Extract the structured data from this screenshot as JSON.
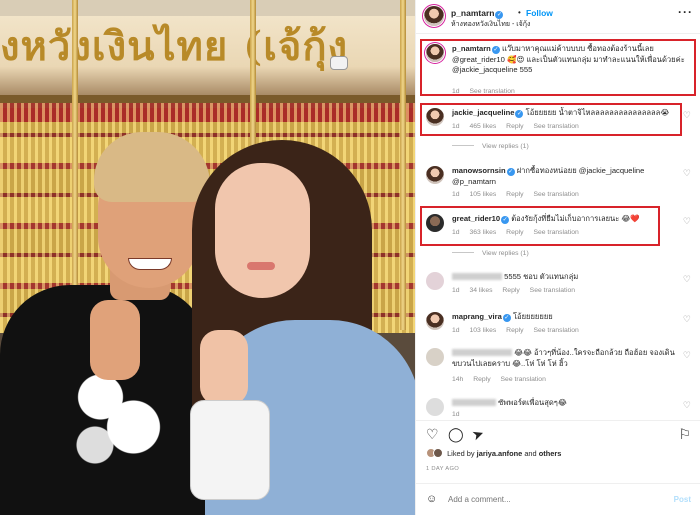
{
  "header": {
    "username": "p_namtarn",
    "follow_label": "Follow",
    "location": "ห้างทองหวังเงินไทย - เจ้กุ้ง",
    "more_icon": "more-horizontal-icon"
  },
  "photo": {
    "sign_text": "งหวังเงินไทย (เจ้กุ้ง"
  },
  "comments": [
    {
      "username": "p_namtarn",
      "verified": true,
      "text": "แว๊บมาหาคุณแม่ค้าบบบบ ซื้อทองต้องร้านนี้เลย @great_rider10 🥰😍 และเป็นตัวแทนกลุ่ม มาทำละแนนให้เพื่อนด้วยค่ะ @jackie_jacqueline 555",
      "time": "1d",
      "translate": "See translation"
    },
    {
      "username": "jackie_jacqueline",
      "verified": true,
      "text": "โอ้ยยยยย น้ำตาจิไหลลลลลลลลลลลลลลล😭",
      "time": "1d",
      "likes": "465 likes",
      "reply": "Reply",
      "translate": "See translation",
      "view_replies": "View replies (1)"
    },
    {
      "username": "manowsornsin",
      "verified": true,
      "text": "ฝากซื้อทองหน่อยย @jackie_jacqueline @p_namtarn",
      "time": "1d",
      "likes": "105 likes",
      "reply": "Reply",
      "translate": "See translation"
    },
    {
      "username": "great_rider10",
      "verified": true,
      "text": "ต้องรัยกุ้งที่ยืมไม่เก็บอาการเลยนะ 😂❤️",
      "time": "1d",
      "likes": "363 likes",
      "reply": "Reply",
      "translate": "See translation",
      "view_replies": "View replies (1)"
    },
    {
      "text": "5555 ชอบ ตัวแทนกลุ่ม",
      "time": "1d",
      "likes": "34 likes",
      "reply": "Reply",
      "translate": "See translation"
    },
    {
      "username": "maprang_vira",
      "verified": true,
      "text": "โอ้ยยยยยยย",
      "time": "1d",
      "likes": "103 likes",
      "reply": "Reply",
      "translate": "See translation"
    },
    {
      "text": "😂😂 อ้าวๆที่น้อง..ใครจะถือกล้วย ถือฮ้อย จองเดินขบวนไปเลยคราบ 😂..โห่ โห่ โห่ ฮิ้ว",
      "time": "14h",
      "reply": "Reply",
      "translate": "See translation"
    },
    {
      "text": "ซัพพอร์ตเพื่อนสุดๆ😂",
      "time": "1d"
    }
  ],
  "actions": {
    "like_icon": "heart-icon",
    "comment_icon": "comment-icon",
    "share_icon": "send-icon",
    "save_icon": "bookmark-icon"
  },
  "likes_line": {
    "prefix": "Liked by",
    "user": "jariya.anfone",
    "and": "and",
    "others": "others"
  },
  "date": "1 DAY AGO",
  "add_comment": {
    "placeholder": "Add a comment...",
    "post_label": "Post"
  }
}
